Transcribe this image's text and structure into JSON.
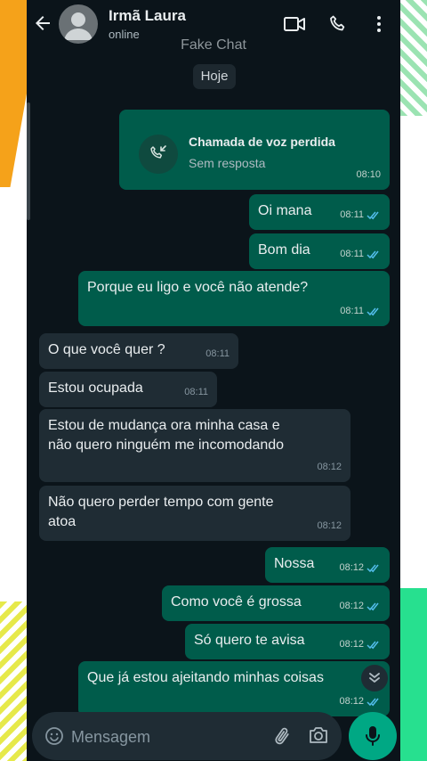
{
  "header": {
    "contact_name": "Irmã Laura",
    "status": "online"
  },
  "watermark": "Fake Chat",
  "date_chip": "Hoje",
  "missed_call": {
    "title": "Chamada de voz perdida",
    "subtitle": "Sem resposta",
    "time": "08:10"
  },
  "messages": [
    {
      "direction": "out",
      "text": "Oi mana",
      "time": "08:11"
    },
    {
      "direction": "out",
      "text": "Bom dia",
      "time": "08:11"
    },
    {
      "direction": "out",
      "text": "Porque eu ligo e você não atende?",
      "time": "08:11"
    },
    {
      "direction": "in",
      "text": "O que você quer ?",
      "time": "08:11"
    },
    {
      "direction": "in",
      "text": "Estou ocupada",
      "time": "08:11"
    },
    {
      "direction": "in",
      "lines": [
        "Estou de mudança ora minha casa e",
        "não quero ninguém me incomodando"
      ],
      "time": "08:12"
    },
    {
      "direction": "in",
      "lines": [
        "Não quero perder tempo com gente",
        "atoa"
      ],
      "time": "08:12"
    },
    {
      "direction": "out",
      "text": "Nossa",
      "time": "08:12"
    },
    {
      "direction": "out",
      "text": "Como você é grossa",
      "time": "08:12"
    },
    {
      "direction": "out",
      "text": "Só quero te avisa",
      "time": "08:12"
    },
    {
      "direction": "out",
      "text": "Que já estou ajeitando minhas coisas",
      "time": "08:12"
    }
  ],
  "composer": {
    "placeholder": "Mensagem"
  },
  "colors": {
    "background": "#0b141a",
    "outgoing_bubble": "#005c4b",
    "incoming_bubble": "#1f2c34",
    "accent": "#00a884",
    "read_tick": "#53bdeb"
  }
}
